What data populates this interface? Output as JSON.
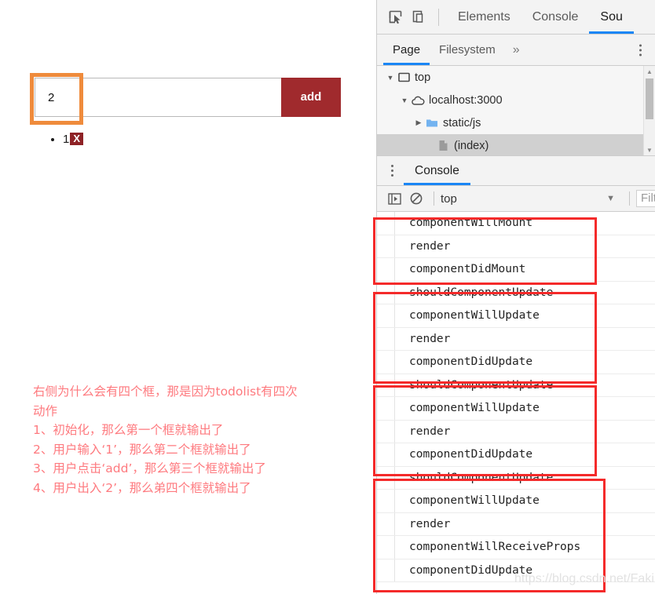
{
  "page": {
    "todo_input": {
      "value": "2",
      "placeholder": ""
    },
    "add_button_label": "add",
    "todo_items": [
      {
        "text": "1",
        "delete_label": "X"
      }
    ],
    "annotation_text": "右侧为什么会有四个框，那是因为todolist有四次\n动作\n1、初始化，那么第一个框就输出了\n2、用户输入‘1’，那么第二个框就输出了\n3、用户点击‘add’，那么第三个框就输出了\n4、用户出入‘2’，那么弟四个框就输出了",
    "highlight_color": "#ef8b3c",
    "accent_color": "#a02a2d"
  },
  "devtools": {
    "main_tabs": [
      {
        "label": "Elements",
        "active": false
      },
      {
        "label": "Console",
        "active": false
      },
      {
        "label": "Sou",
        "active": true
      }
    ],
    "sub_tabs": [
      {
        "label": "Page",
        "active": true
      },
      {
        "label": "Filesystem",
        "active": false
      }
    ],
    "more_tabs_label": "»",
    "tree": [
      {
        "label": "top",
        "icon": "window-icon",
        "arrow": "expanded",
        "indent": 0,
        "selected": false
      },
      {
        "label": "localhost:3000",
        "icon": "cloud-icon",
        "arrow": "expanded",
        "indent": 1,
        "selected": false
      },
      {
        "label": "static/js",
        "icon": "folder-icon",
        "arrow": "collapsed",
        "indent": 2,
        "selected": false
      },
      {
        "label": "(index)",
        "icon": "file-icon",
        "arrow": "none",
        "indent": 3,
        "selected": true
      }
    ],
    "drawer_tab": "Console",
    "console_toolbar": {
      "context": "top",
      "filter_placeholder": "Filter"
    },
    "console_groups": [
      {
        "entries": [
          "componentWillMount",
          "render",
          "componentDidMount"
        ]
      },
      {
        "entries": [
          "shouldComponentUpdate",
          "componentWillUpdate",
          "render",
          "componentDidUpdate"
        ]
      },
      {
        "entries": [
          "shouldComponentUpdate",
          "componentWillUpdate",
          "render",
          "componentDidUpdate"
        ]
      },
      {
        "entries": [
          "shouldComponentUpdate",
          "componentWillUpdate",
          "render",
          "componentWillReceiveProps",
          "componentDidUpdate"
        ]
      }
    ],
    "annotation_box_color": "#f42a2a"
  },
  "watermark": "https://blog.csdn.net/Fakin"
}
